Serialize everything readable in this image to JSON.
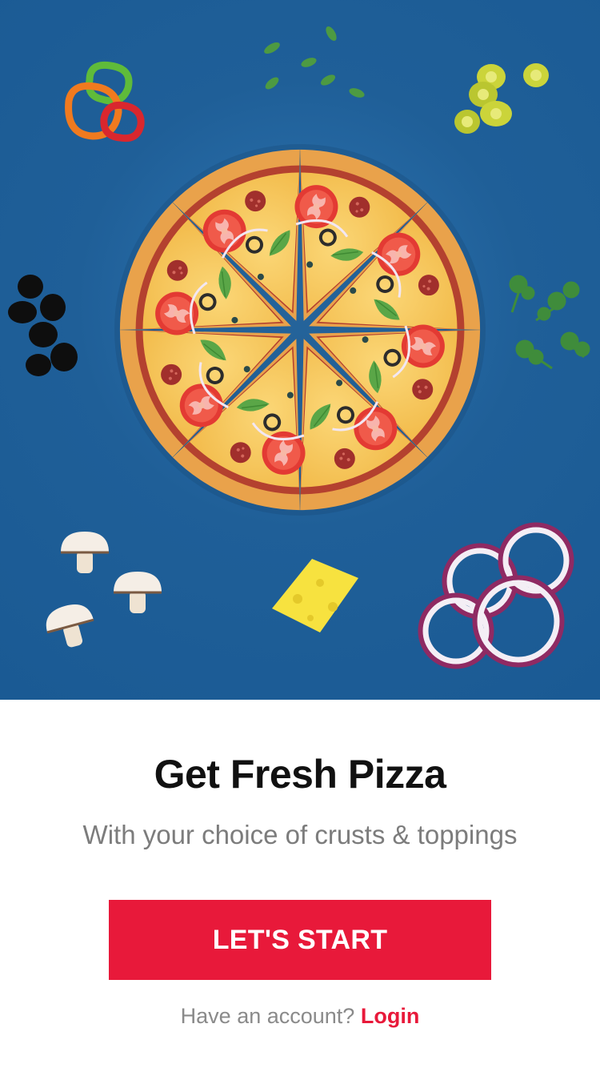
{
  "hero": {
    "illustration": "pizza-with-toppings",
    "background_color": "#1f5f98"
  },
  "content": {
    "title": "Get Fresh Pizza",
    "subtitle": "With your choice of crusts & toppings"
  },
  "cta": {
    "label": "LET'S START",
    "color": "#e8193a"
  },
  "login": {
    "prompt": "Have an account?",
    "link_label": "Login"
  }
}
